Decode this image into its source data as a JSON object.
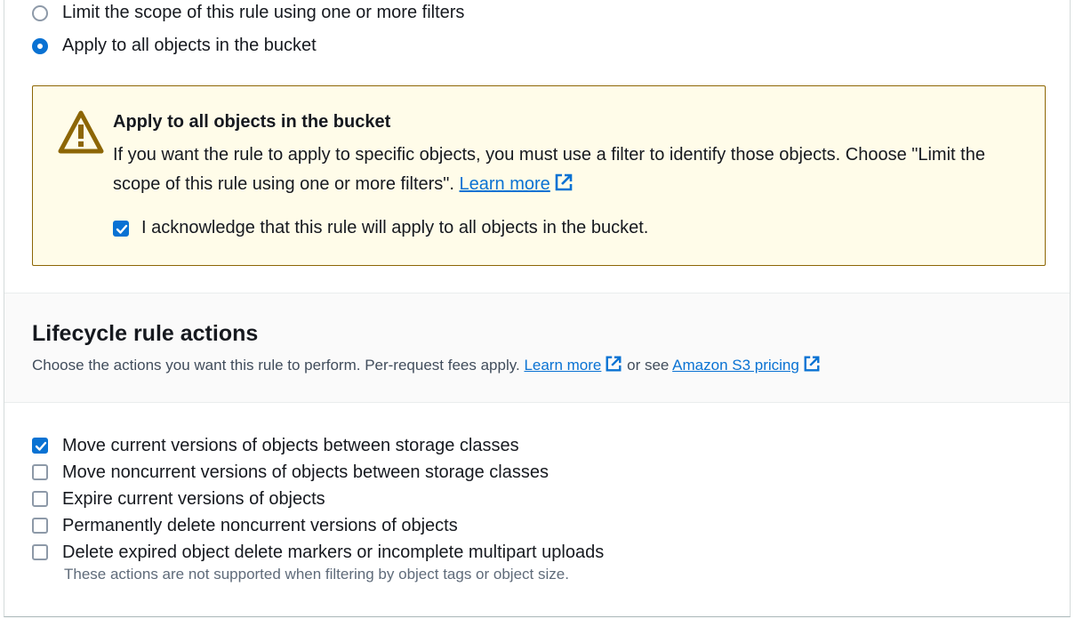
{
  "scope": {
    "options": [
      {
        "label": "Limit the scope of this rule using one or more filters",
        "checked": false
      },
      {
        "label": "Apply to all objects in the bucket",
        "checked": true
      }
    ]
  },
  "warning": {
    "icon": "warning-triangle-icon",
    "title": "Apply to all objects in the bucket",
    "body": "If you want the rule to apply to specific objects, you must use a filter to identify those objects. Choose \"Limit the scope of this rule using one or more filters\".",
    "learn_more": "Learn more",
    "acknowledge_label": "I acknowledge that this rule will apply to all objects in the bucket.",
    "acknowledge_checked": true
  },
  "lifecycle": {
    "title": "Lifecycle rule actions",
    "description": "Choose the actions you want this rule to perform. Per-request fees apply.",
    "learn_more": "Learn more",
    "or_see": "or see",
    "pricing_link": "Amazon S3 pricing",
    "actions": [
      {
        "label": "Move current versions of objects between storage classes",
        "checked": true
      },
      {
        "label": "Move noncurrent versions of objects between storage classes",
        "checked": false
      },
      {
        "label": "Expire current versions of objects",
        "checked": false
      },
      {
        "label": "Permanently delete noncurrent versions of objects",
        "checked": false
      },
      {
        "label": "Delete expired object delete markers or incomplete multipart uploads",
        "checked": false
      }
    ],
    "hint": "These actions are not supported when filtering by object tags or object size."
  },
  "colors": {
    "accent": "#0972d3",
    "warning_bg": "#fffce9",
    "warning_border": "#8d6605",
    "warning_icon": "#8d6605"
  }
}
